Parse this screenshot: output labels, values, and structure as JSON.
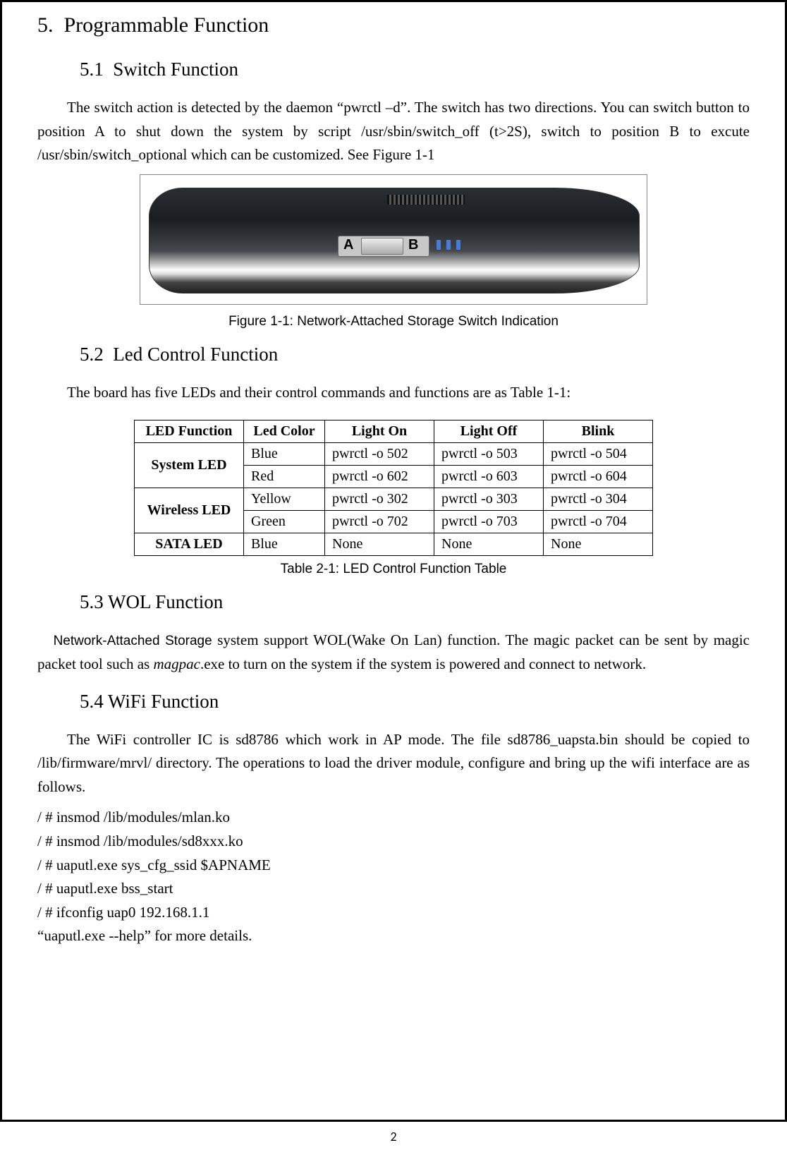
{
  "section": {
    "number": "5.",
    "title": "Programmable Function"
  },
  "sub1": {
    "number": "5.1",
    "title": "Switch Function",
    "paragraph": "The switch action is detected by the daemon “pwrctl –d”. The switch has two directions. You can switch button to position A to shut down the system by script /usr/sbin/switch_off (t>2S), switch to position B to excute /usr/sbin/switch_optional which can be customized. See Figure 1-1"
  },
  "figure1": {
    "label": "Figure 1-1:",
    "caption": "Network-Attached Storage Switch Indication",
    "labelA": "A",
    "labelB": "B"
  },
  "sub2": {
    "number": "5.2",
    "title": "Led Control Function",
    "paragraph": "The board has five LEDs and their control commands and functions are as Table 1-1:"
  },
  "ledTable": {
    "headers": [
      "LED Function",
      "Led Color",
      "Light On",
      "Light Off",
      "Blink"
    ],
    "rows": [
      {
        "func": "System LED",
        "rowspan": 2,
        "color": "Blue",
        "on": "pwrctl -o 502",
        "off": "pwrctl -o 503",
        "blink": "pwrctl -o 504"
      },
      {
        "color": "Red",
        "on": "pwrctl -o 602",
        "off": "pwrctl -o 603",
        "blink": "pwrctl -o 604"
      },
      {
        "func": "Wireless LED",
        "rowspan": 2,
        "color": "Yellow",
        "on": "pwrctl -o 302",
        "off": "pwrctl -o 303",
        "blink": "pwrctl -o 304"
      },
      {
        "color": "Green",
        "on": "pwrctl -o 702",
        "off": "pwrctl -o 703",
        "blink": "pwrctl -o 704"
      },
      {
        "func": "SATA LED",
        "rowspan": 1,
        "color": "Blue",
        "on": "None",
        "off": "None",
        "blink": "None"
      }
    ],
    "caption": "Table 2-1: LED Control Function Table"
  },
  "sub3": {
    "number": "5.3",
    "title": "WOL Function",
    "prefix": "Network-Attached Storage",
    "paragraph": " system support WOL(Wake On Lan) function. The magic packet can be sent by magic packet tool such as ",
    "italic": "magpac",
    "suffix": ".exe to turn on the system if the system is powered and connect to network."
  },
  "sub4": {
    "number": "5.4",
    "title": "WiFi Function",
    "paragraph": "The WiFi controller IC is sd8786 which work in AP mode. The file sd8786_uapsta.bin should be copied to /lib/firmware/mrvl/ directory. The operations to load the driver module, configure and bring up the wifi interface are as follows.",
    "commands": [
      "/ # insmod /lib/modules/mlan.ko",
      "/ # insmod /lib/modules/sd8xxx.ko",
      "/ # uaputl.exe sys_cfg_ssid $APNAME",
      "/ # uaputl.exe bss_start",
      "/ # ifconfig uap0 192.168.1.1",
      "“uaputl.exe --help” for more details."
    ]
  },
  "pageNumber": "2"
}
